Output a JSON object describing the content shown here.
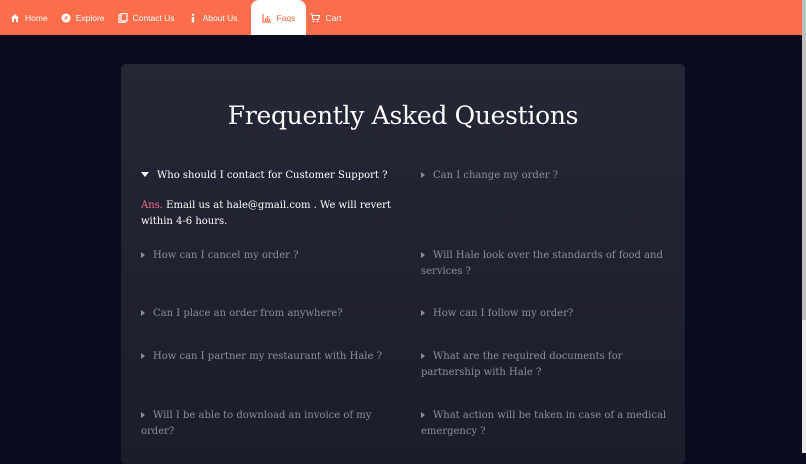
{
  "nav": {
    "items": [
      {
        "label": "Home",
        "icon": "home-icon"
      },
      {
        "label": "Explore",
        "icon": "compass-icon"
      },
      {
        "label": "Contact Us",
        "icon": "clipboard-icon"
      },
      {
        "label": "About Us",
        "icon": "info-icon"
      },
      {
        "label": "Faqs",
        "icon": "chart-icon",
        "active": true
      },
      {
        "label": "Cart",
        "icon": "cart-icon"
      }
    ],
    "accent": "#fc6d4b"
  },
  "faq": {
    "title": "Frequently Asked Questions",
    "answer_prefix": "Ans.",
    "answer_text": "Email us at hale@gmail.com . We will revert within 4-6 hours.",
    "questions": [
      {
        "q": "Who should I contact for Customer Support ?",
        "open": true
      },
      {
        "q": "Can I change my order ?"
      },
      {
        "q": "How can I cancel my order ?"
      },
      {
        "q": "Will Hale look over the standards of food and services ?"
      },
      {
        "q": "Can I place an order from anywhere?"
      },
      {
        "q": "How can I follow my order?"
      },
      {
        "q": "How can I partner my restaurant with Hale ?"
      },
      {
        "q": "What are the required documents for partnership with Hale ?"
      },
      {
        "q": "Will I be able to download an invoice of my order?"
      },
      {
        "q": "What action will be taken in case of a medical emergency ?"
      }
    ]
  },
  "colors": {
    "background": "#0a0b1d",
    "card": "#222333",
    "muted_text": "#8e8f9a",
    "answer_accent": "#fc6d8b"
  }
}
